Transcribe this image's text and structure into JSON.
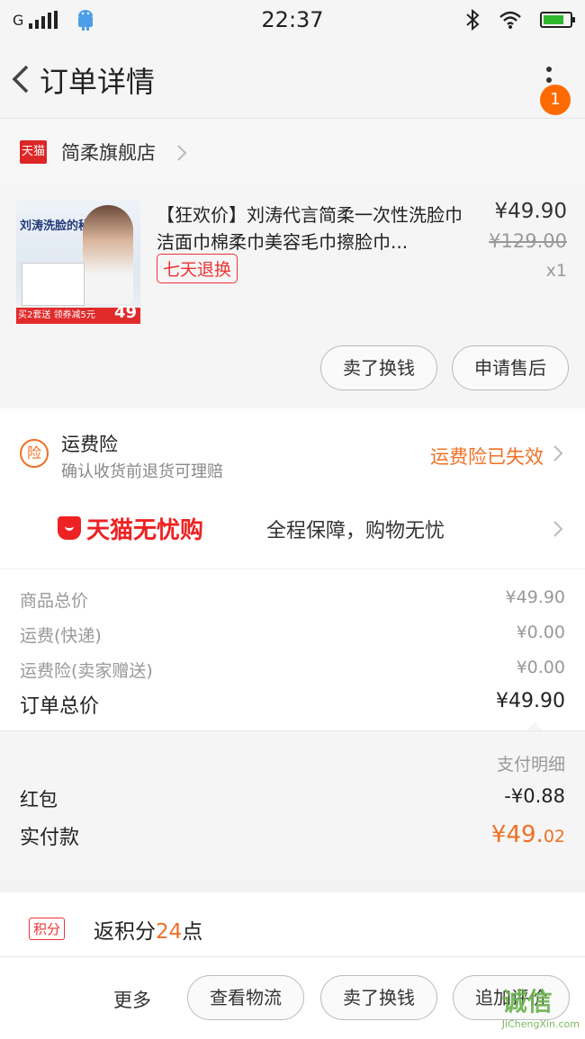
{
  "status_bar": {
    "network": "G",
    "time": "22:37"
  },
  "nav": {
    "title": "订单详情",
    "badge": "1"
  },
  "shop": {
    "logo_text": "天猫",
    "name": "简柔旗舰店"
  },
  "item": {
    "title": "【狂欢价】刘涛代言简柔一次性洗脸巾洁面巾棉柔巾美容毛巾擦脸巾...",
    "thumb_text": "刘涛洗脸的秘密",
    "thumb_promo": "买2套送 领券减5元",
    "thumb_price": "49",
    "return_tag": "七天退换",
    "price": "¥49.90",
    "original_price": "¥129.00",
    "quantity": "x1",
    "btn_sell": "卖了换钱",
    "btn_aftersale": "申请售后"
  },
  "insurance": {
    "icon_text": "险",
    "title": "运费险",
    "subtitle": "确认收货前退货可理赔",
    "status": "运费险已失效"
  },
  "guarantee": {
    "logo": "天猫无忧购",
    "text": "全程保障，购物无忧"
  },
  "summary": {
    "rows": [
      {
        "label": "商品总价",
        "value": "¥49.90"
      },
      {
        "label": "运费(快递)",
        "value": "¥0.00"
      },
      {
        "label": "运费险(卖家赠送)",
        "value": "¥0.00"
      }
    ],
    "total_label": "订单总价",
    "total_value": "¥49.90"
  },
  "payment": {
    "detail_label": "支付明细",
    "redpacket_label": "红包",
    "redpacket_value": "-¥0.88",
    "actual_label": "实付款",
    "actual_main": "¥49.",
    "actual_decimal": "02"
  },
  "points": {
    "tag": "积分",
    "prefix": "返积分",
    "num": "24",
    "suffix": "点"
  },
  "bottom_bar": {
    "more": "更多",
    "logistics": "查看物流",
    "sell": "卖了换钱",
    "review": "追加评价"
  },
  "watermark": {
    "cn": "诚信",
    "en": "JiChengXin.com"
  },
  "colors": {
    "accent": "#f07025",
    "tmall_red": "#dd2727"
  }
}
